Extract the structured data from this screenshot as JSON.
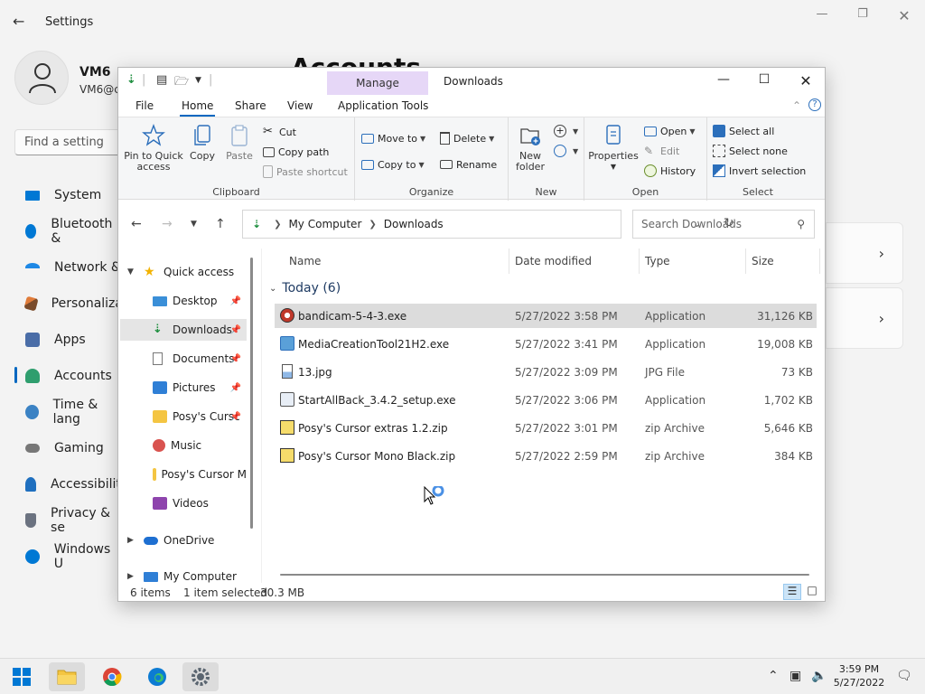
{
  "settings": {
    "title": "Settings",
    "user_name": "VM6",
    "user_email": "VM6@c",
    "page_heading": "Accounts",
    "search_placeholder": "Find a setting",
    "nav": [
      {
        "label": "System",
        "color": "#0078d4"
      },
      {
        "label": "Bluetooth &",
        "color": "#0078d4"
      },
      {
        "label": "Network &",
        "color": "#1e88e5"
      },
      {
        "label": "Personaliza",
        "color": "#e07b39"
      },
      {
        "label": "Apps",
        "color": "#4a6da7"
      },
      {
        "label": "Accounts",
        "color": "#2f9e6e"
      },
      {
        "label": "Time & lang",
        "color": "#3b82c4"
      },
      {
        "label": "Gaming",
        "color": "#777777"
      },
      {
        "label": "Accessibilit",
        "color": "#1f6fbf"
      },
      {
        "label": "Privacy & se",
        "color": "#6b7280"
      },
      {
        "label": "Windows U",
        "color": "#0078d4"
      }
    ]
  },
  "explorer": {
    "title": "Downloads",
    "context_tab": "Manage",
    "menu_tabs": [
      "File",
      "Home",
      "Share",
      "View",
      "Application Tools"
    ],
    "ribbon": {
      "clipboard": {
        "label": "Clipboard",
        "pin": "Pin to Quick access",
        "copy": "Copy",
        "paste": "Paste",
        "cut": "Cut",
        "copy_path": "Copy path",
        "paste_shortcut": "Paste shortcut"
      },
      "organize": {
        "label": "Organize",
        "move_to": "Move to",
        "copy_to": "Copy to",
        "delete": "Delete",
        "rename": "Rename"
      },
      "new": {
        "label": "New",
        "new_folder": "New folder"
      },
      "open": {
        "label": "Open",
        "properties": "Properties",
        "open": "Open",
        "edit": "Edit",
        "history": "History"
      },
      "select": {
        "label": "Select",
        "select_all": "Select all",
        "select_none": "Select none",
        "invert": "Invert selection"
      }
    },
    "address": {
      "crumbs": [
        "My Computer",
        "Downloads"
      ],
      "search_placeholder": "Search Downloads"
    },
    "tree": {
      "quick_access": "Quick access",
      "items": [
        "Desktop",
        "Downloads",
        "Documents",
        "Pictures",
        "Posy's Cursc",
        "Music",
        "Posy's Cursor M",
        "Videos"
      ],
      "onedrive": "OneDrive",
      "my_computer": "My Computer"
    },
    "columns": [
      "Name",
      "Date modified",
      "Type",
      "Size"
    ],
    "group": "Today (6)",
    "files": [
      {
        "name": "bandicam-5-4-3.exe",
        "date": "5/27/2022 3:58 PM",
        "type": "Application",
        "size": "31,126 KB"
      },
      {
        "name": "MediaCreationTool21H2.exe",
        "date": "5/27/2022 3:41 PM",
        "type": "Application",
        "size": "19,008 KB"
      },
      {
        "name": "13.jpg",
        "date": "5/27/2022 3:09 PM",
        "type": "JPG File",
        "size": "73 KB"
      },
      {
        "name": "StartAllBack_3.4.2_setup.exe",
        "date": "5/27/2022 3:06 PM",
        "type": "Application",
        "size": "1,702 KB"
      },
      {
        "name": "Posy's Cursor extras 1.2.zip",
        "date": "5/27/2022 3:01 PM",
        "type": "zip Archive",
        "size": "5,646 KB"
      },
      {
        "name": "Posy's Cursor Mono Black.zip",
        "date": "5/27/2022 2:59 PM",
        "type": "zip Archive",
        "size": "384 KB"
      }
    ],
    "status": {
      "count": "6 items",
      "selected": "1 item selected",
      "size": "30.3 MB"
    }
  },
  "taskbar": {
    "time": "3:59 PM",
    "date": "5/27/2022"
  },
  "colors": {
    "accent": "#0067c0",
    "manage_tab": "#e6d7f7",
    "selection": "#dcdcdc"
  }
}
